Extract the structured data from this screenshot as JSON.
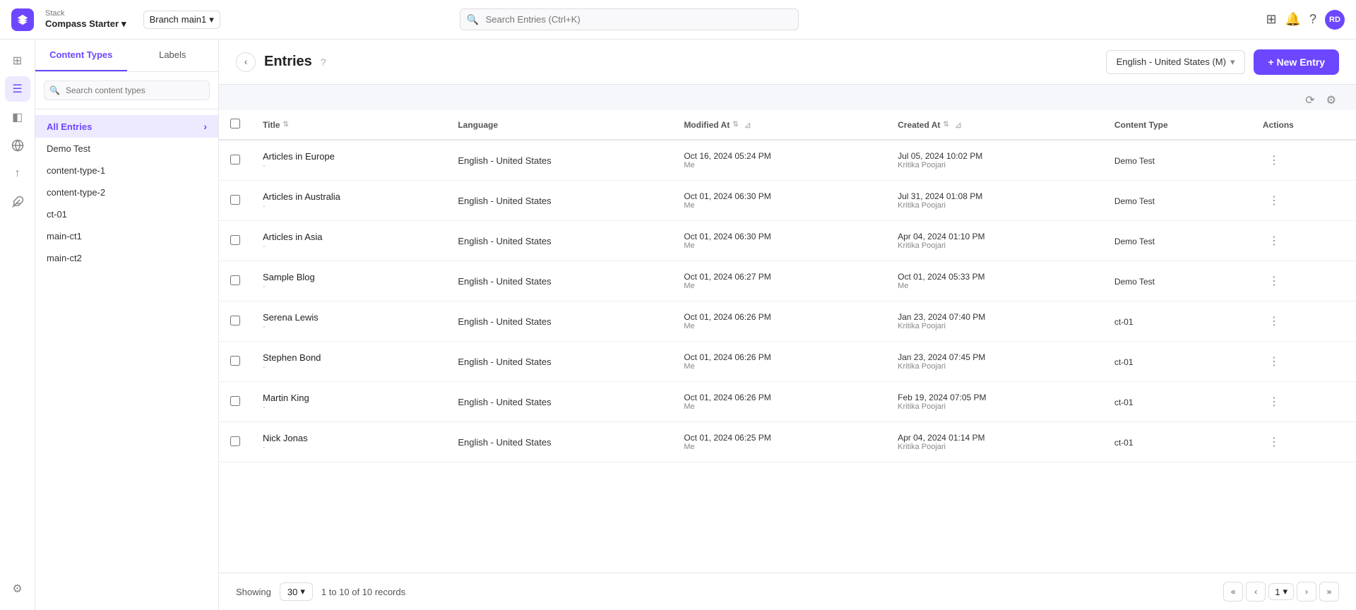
{
  "app": {
    "stack_label": "Stack",
    "brand_name": "Compass Starter",
    "branch_label": "Branch",
    "branch_name": "main1"
  },
  "topbar": {
    "search_placeholder": "Search Entries (Ctrl+K)",
    "avatar_text": "RD"
  },
  "sidebar": {
    "tab_content_types": "Content Types",
    "tab_labels": "Labels",
    "search_placeholder": "Search content types",
    "all_entries_label": "All Entries",
    "items": [
      {
        "label": "Demo Test"
      },
      {
        "label": "content-type-1"
      },
      {
        "label": "content-type-2"
      },
      {
        "label": "ct-01"
      },
      {
        "label": "main-ct1"
      },
      {
        "label": "main-ct2"
      }
    ]
  },
  "main": {
    "back_button": "‹",
    "page_title": "Entries",
    "help_icon": "?",
    "language_label": "English - United States (M)",
    "new_entry_label": "+ New Entry"
  },
  "toolbar": {
    "refresh_icon": "⟳",
    "settings_icon": "⚙"
  },
  "table": {
    "columns": [
      {
        "key": "title",
        "label": "Title"
      },
      {
        "key": "language",
        "label": "Language"
      },
      {
        "key": "modified_at",
        "label": "Modified At"
      },
      {
        "key": "created_at",
        "label": "Created At"
      },
      {
        "key": "content_type",
        "label": "Content Type"
      },
      {
        "key": "actions",
        "label": "Actions"
      }
    ],
    "rows": [
      {
        "title": "Articles in Europe",
        "subtitle": "-",
        "language": "English - United States",
        "modified_at": "Oct 16, 2024 05:24 PM",
        "modified_by": "Me",
        "created_at": "Jul 05, 2024 10:02 PM",
        "created_by": "Kritika Poojari",
        "content_type": "Demo Test"
      },
      {
        "title": "Articles in Australia",
        "subtitle": "-",
        "language": "English - United States",
        "modified_at": "Oct 01, 2024 06:30 PM",
        "modified_by": "Me",
        "created_at": "Jul 31, 2024 01:08 PM",
        "created_by": "Kritika Poojari",
        "content_type": "Demo Test"
      },
      {
        "title": "Articles in Asia",
        "subtitle": "-",
        "language": "English - United States",
        "modified_at": "Oct 01, 2024 06:30 PM",
        "modified_by": "Me",
        "created_at": "Apr 04, 2024 01:10 PM",
        "created_by": "Kritika Poojari",
        "content_type": "Demo Test"
      },
      {
        "title": "Sample Blog",
        "subtitle": "-",
        "language": "English - United States",
        "modified_at": "Oct 01, 2024 06:27 PM",
        "modified_by": "Me",
        "created_at": "Oct 01, 2024 05:33 PM",
        "created_by": "Me",
        "content_type": "Demo Test"
      },
      {
        "title": "Serena Lewis",
        "subtitle": "-",
        "language": "English - United States",
        "modified_at": "Oct 01, 2024 06:26 PM",
        "modified_by": "Me",
        "created_at": "Jan 23, 2024 07:40 PM",
        "created_by": "Kritika Poojari",
        "content_type": "ct-01"
      },
      {
        "title": "Stephen Bond",
        "subtitle": "-",
        "language": "English - United States",
        "modified_at": "Oct 01, 2024 06:26 PM",
        "modified_by": "Me",
        "created_at": "Jan 23, 2024 07:45 PM",
        "created_by": "Kritika Poojari",
        "content_type": "ct-01"
      },
      {
        "title": "Martin King",
        "subtitle": "-",
        "language": "English - United States",
        "modified_at": "Oct 01, 2024 06:26 PM",
        "modified_by": "Me",
        "created_at": "Feb 19, 2024 07:05 PM",
        "created_by": "Kritika Poojari",
        "content_type": "ct-01"
      },
      {
        "title": "Nick Jonas",
        "subtitle": "-",
        "language": "English - United States",
        "modified_at": "Oct 01, 2024 06:25 PM",
        "modified_by": "Me",
        "created_at": "Apr 04, 2024 01:14 PM",
        "created_by": "Kritika Poojari",
        "content_type": "ct-01"
      }
    ]
  },
  "footer": {
    "showing_label": "Showing",
    "per_page": "30",
    "records_label": "1 to 10 of 10 records",
    "current_page": "1"
  },
  "icons": {
    "dashboard": "⊞",
    "list": "☰",
    "layers": "◫",
    "globe": "⊕",
    "upload": "↑",
    "puzzle": "⊕",
    "settings": "⚙",
    "search": "🔍",
    "bell": "🔔",
    "help": "?",
    "back": "‹",
    "chevron_down": "▾",
    "chevron_right": "›",
    "sort": "⇅",
    "filter": "⊿",
    "refresh": "⟳",
    "gear": "⚙",
    "dots": "⋮",
    "first": "«",
    "prev": "‹",
    "next": "›",
    "last": "»"
  }
}
